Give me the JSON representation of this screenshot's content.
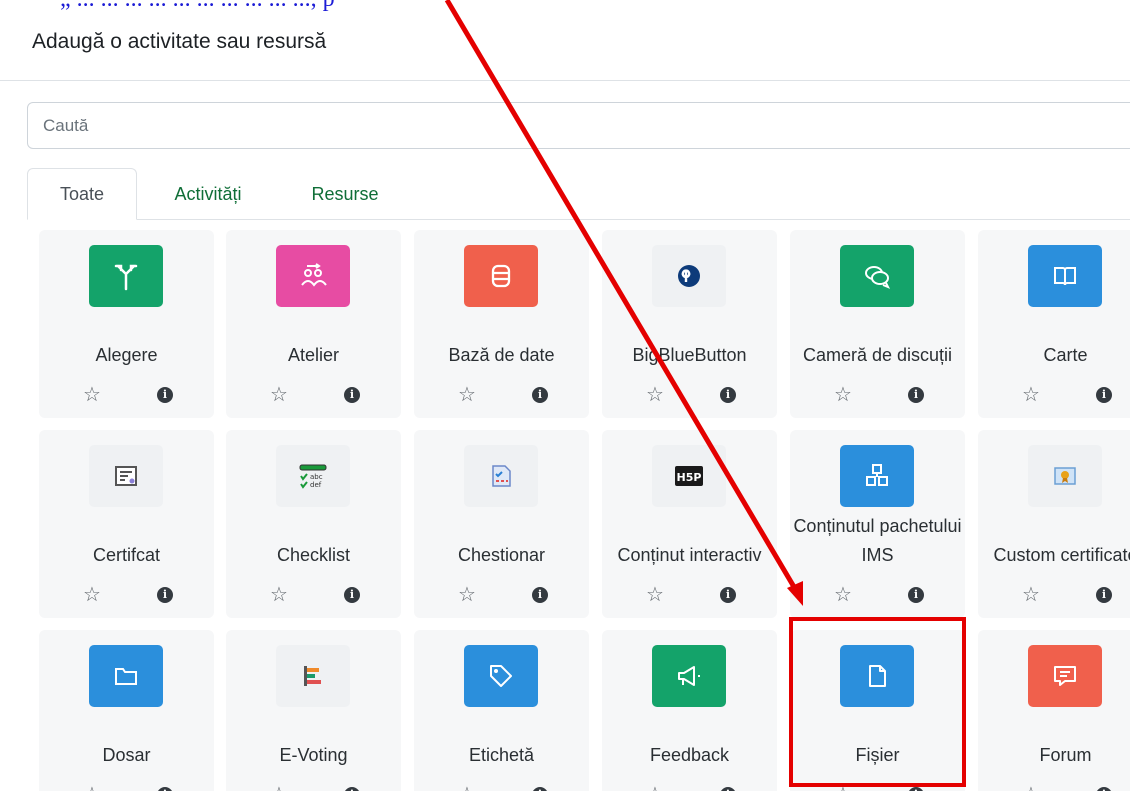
{
  "header": {
    "top_fragment": "„ ... ... ... ... ... ... ... ... ... ..., p",
    "title": "Adaugă o activitate sau resursă"
  },
  "search": {
    "placeholder": "Caută",
    "value": ""
  },
  "tabs": [
    {
      "label": "Toate",
      "active": true
    },
    {
      "label": "Activități",
      "active": false
    },
    {
      "label": "Resurse",
      "active": false
    }
  ],
  "items": [
    {
      "label": "Alegere",
      "icon": "signpost-icon",
      "color": "#14a36a"
    },
    {
      "label": "Atelier",
      "icon": "workshop-icon",
      "color": "#e74ca3"
    },
    {
      "label": "Bază de date",
      "icon": "database-icon",
      "color": "#f0604c"
    },
    {
      "label": "BigBlueButton",
      "icon": "bigbluebutton-icon",
      "color": "#eff1f3"
    },
    {
      "label": "Cameră de discuții",
      "icon": "chat-icon",
      "color": "#14a36a"
    },
    {
      "label": "Carte",
      "icon": "book-icon",
      "color": "#2b8fdc"
    },
    {
      "label": "Certifcat",
      "icon": "certificate-icon",
      "color": "#eff1f3"
    },
    {
      "label": "Checklist",
      "icon": "checklist-icon",
      "color": "#eff1f3"
    },
    {
      "label": "Chestionar",
      "icon": "questionnaire-icon",
      "color": "#eff1f3"
    },
    {
      "label": "Conținut interactiv",
      "icon": "h5p-icon",
      "color": "#eff1f3"
    },
    {
      "label": "Conținutul pachetului IMS",
      "icon": "ims-package-icon",
      "color": "#2b8fdc"
    },
    {
      "label": "Custom certificate",
      "icon": "custom-certificate-icon",
      "color": "#eff1f3"
    },
    {
      "label": "Dosar",
      "icon": "folder-icon",
      "color": "#2b8fdc"
    },
    {
      "label": "E-Voting",
      "icon": "evoting-icon",
      "color": "#eff1f3"
    },
    {
      "label": "Etichetă",
      "icon": "tag-icon",
      "color": "#2b8fdc"
    },
    {
      "label": "Feedback",
      "icon": "megaphone-icon",
      "color": "#14a36a"
    },
    {
      "label": "Fișier",
      "icon": "file-icon",
      "color": "#2b8fdc",
      "highlighted": true
    },
    {
      "label": "Forum",
      "icon": "forum-icon",
      "color": "#f0604c"
    }
  ],
  "card_actions": {
    "star_glyph": "☆",
    "info_glyph": "i"
  },
  "annotation": {
    "color": "#e40000"
  }
}
